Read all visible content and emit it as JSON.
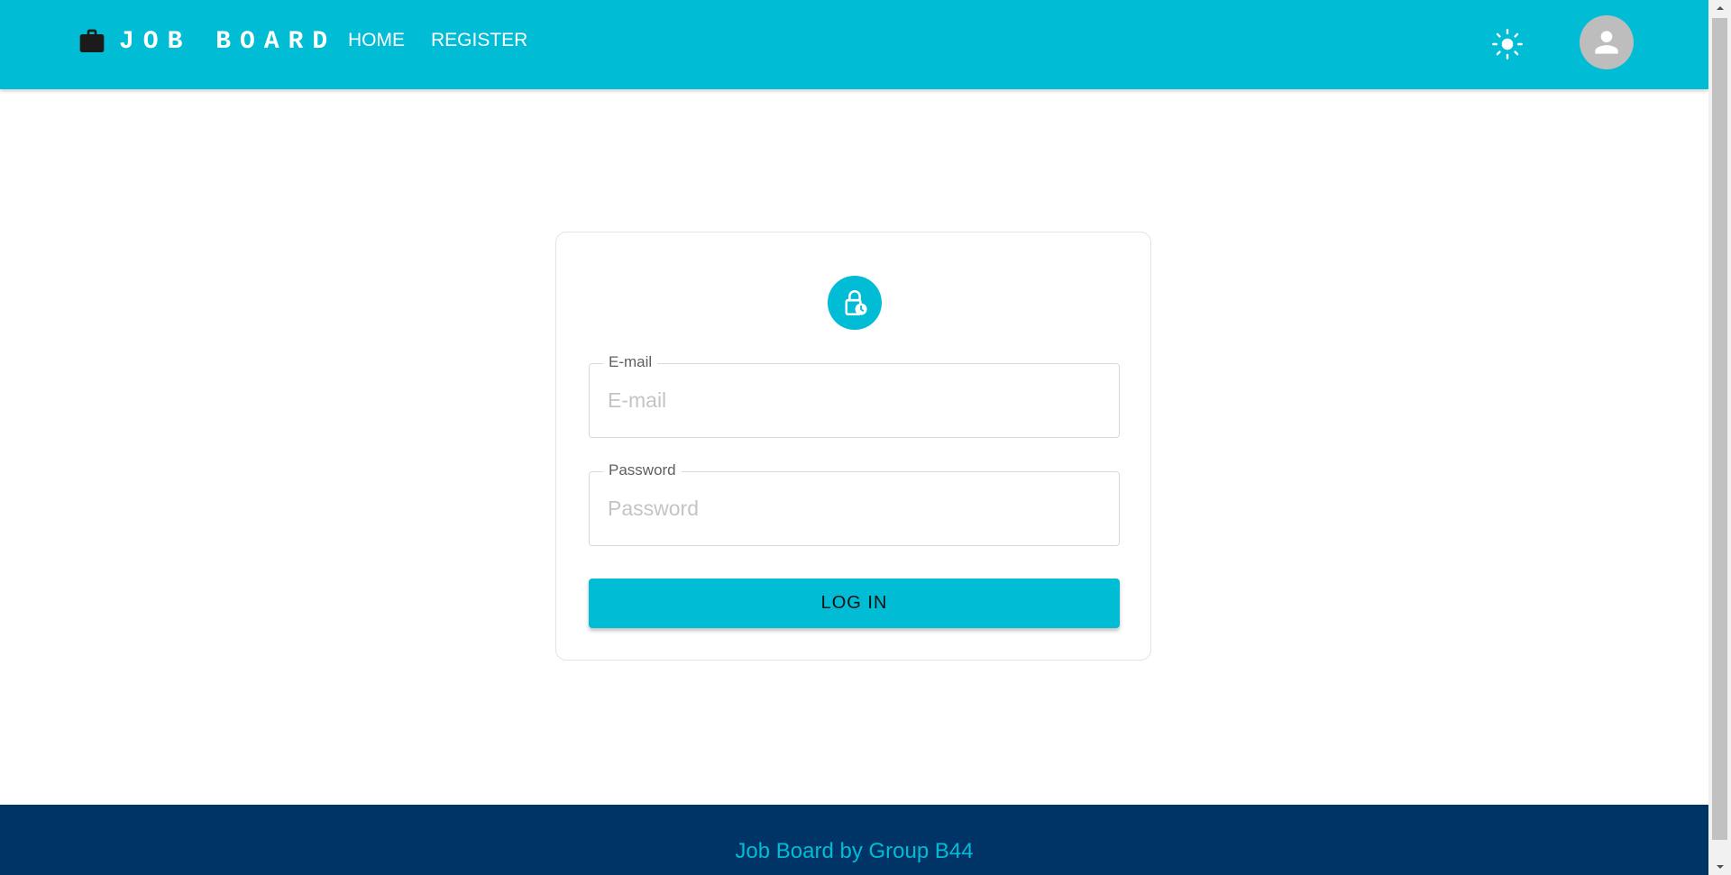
{
  "colors": {
    "appbar": "#00bcd4",
    "footer": "#003366",
    "accent": "#00bcd4",
    "avatar": "#bdbdbd"
  },
  "header": {
    "brand_icon": "briefcase-icon",
    "brand_title": "JOB BOARD",
    "nav": [
      {
        "label": "HOME"
      },
      {
        "label": "REGISTER"
      }
    ],
    "theme_toggle_icon": "sun-icon",
    "avatar_icon": "person-icon"
  },
  "login": {
    "badge_icon": "lock-clock-icon",
    "email": {
      "label": "E-mail",
      "placeholder": "E-mail",
      "value": ""
    },
    "password": {
      "label": "Password",
      "placeholder": "Password",
      "value": ""
    },
    "submit_label": "LOG IN"
  },
  "footer": {
    "text": "Job Board by Group B44"
  }
}
